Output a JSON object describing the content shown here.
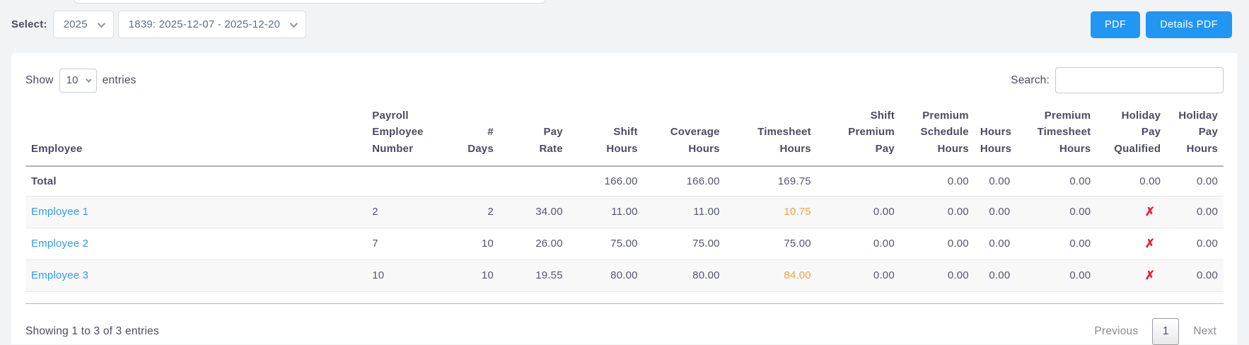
{
  "topbar": {
    "select_label": "Select:",
    "year_select": {
      "value": "2025"
    },
    "period_select": {
      "value": "1839: 2025-12-07 - 2025-12-20"
    },
    "pdf_button": "PDF",
    "details_pdf_button": "Details PDF"
  },
  "toolbar": {
    "show_label": "Show",
    "entries_select": {
      "value": "10"
    },
    "entries_label": "entries",
    "search_label": "Search:",
    "search_input": {
      "value": "",
      "placeholder": ""
    }
  },
  "table": {
    "headers": {
      "employee": "Employee",
      "payroll_employee_number": "Payroll\nEmployee\nNumber",
      "num_days": "#\nDays",
      "pay_rate": "Pay\nRate",
      "shift_hours": "Shift\nHours",
      "coverage_hours": "Coverage\nHours",
      "timesheet_hours": "Timesheet\nHours",
      "shift_premium_pay": "Shift\nPremium\nPay",
      "premium_schedule_hours": "Premium\nSchedule\nHours",
      "hours_hours": "Hours\nHours",
      "premium_timesheet_hours": "Premium\nTimesheet\nHours",
      "holiday_pay_qualified": "Holiday\nPay\nQualified",
      "holiday_pay_hours": "Holiday\nPay\nHours"
    },
    "rows": [
      {
        "employee": "Total",
        "payroll_employee_number": "",
        "num_days": "",
        "pay_rate": "",
        "shift_hours": "166.00",
        "coverage_hours": "166.00",
        "timesheet_hours": "169.75",
        "shift_premium_pay": "",
        "premium_schedule_hours": "0.00",
        "hours_hours": "0.00",
        "premium_timesheet_hours": "0.00",
        "holiday_pay_qualified": "0.00",
        "holiday_pay_hours": "0.00"
      },
      {
        "employee": "Employee 1",
        "payroll_employee_number": "2",
        "num_days": "2",
        "pay_rate": "34.00",
        "shift_hours": "11.00",
        "coverage_hours": "11.00",
        "timesheet_hours": "10.75",
        "shift_premium_pay": "0.00",
        "premium_schedule_hours": "0.00",
        "hours_hours": "0.00",
        "premium_timesheet_hours": "0.00",
        "holiday_pay_qualified": "✗",
        "holiday_pay_hours": "0.00"
      },
      {
        "employee": "Employee 2",
        "payroll_employee_number": "7",
        "num_days": "10",
        "pay_rate": "26.00",
        "shift_hours": "75.00",
        "coverage_hours": "75.00",
        "timesheet_hours": "75.00",
        "shift_premium_pay": "0.00",
        "premium_schedule_hours": "0.00",
        "hours_hours": "0.00",
        "premium_timesheet_hours": "0.00",
        "holiday_pay_qualified": "✗",
        "holiday_pay_hours": "0.00"
      },
      {
        "employee": "Employee 3",
        "payroll_employee_number": "10",
        "num_days": "10",
        "pay_rate": "19.55",
        "shift_hours": "80.00",
        "coverage_hours": "80.00",
        "timesheet_hours": "84.00",
        "shift_premium_pay": "0.00",
        "premium_schedule_hours": "0.00",
        "hours_hours": "0.00",
        "premium_timesheet_hours": "0.00",
        "holiday_pay_qualified": "✗",
        "holiday_pay_hours": "0.00"
      }
    ]
  },
  "footer": {
    "showing_text": "Showing 1 to 3 of 3 entries",
    "previous_label": "Previous",
    "page_number": "1",
    "next_label": "Next"
  },
  "colors": {
    "accent_blue": "#2196f3",
    "link_blue": "#2e9cf4",
    "highlight_orange": "#f0a43c",
    "error_red": "#ea1e2c"
  }
}
